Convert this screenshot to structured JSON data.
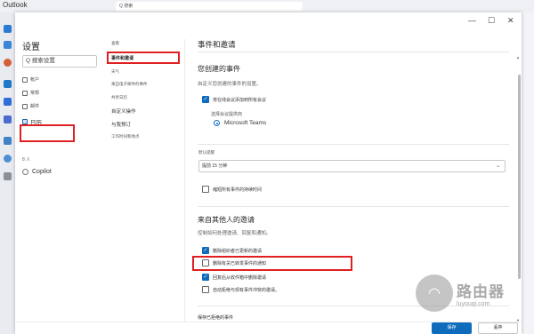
{
  "app": {
    "title": "Outlook",
    "search_placeholder": "Q 搜索"
  },
  "dialog": {
    "controls": {
      "minimize": "—",
      "maximize": "☐",
      "close": "✕"
    },
    "settings_title": "设置",
    "search_placeholder": "Q 搜索设置",
    "nav_primary": [
      {
        "label": "帐户",
        "icon": "person-icon"
      },
      {
        "label": "常规",
        "icon": "settings-icon"
      },
      {
        "label": "邮件",
        "icon": "mail-icon"
      },
      {
        "label": "日历",
        "icon": "calendar-icon",
        "selected": true
      }
    ],
    "people_label": "8 人",
    "copilot_label": "Copilot",
    "nav_secondary": [
      {
        "label": "查看"
      },
      {
        "label": "事件和邀请",
        "selected": true
      },
      {
        "label": "天气"
      },
      {
        "label": "来自电子邮件的事件"
      },
      {
        "label": "共享日历"
      },
      {
        "label": "自定义操作"
      },
      {
        "label": "与我预订"
      },
      {
        "label": "工作时间和地点"
      }
    ],
    "content": {
      "title": "事件和邀请",
      "section1_title": "您创建的事件",
      "section1_desc": "自定义您创建的事件的设置。",
      "cb_add_online_meeting": "将在线会议添加到所有会议",
      "provider_label": "选择会议提供商",
      "provider_option": "Microsoft Teams",
      "reminder_label": "默认提醒",
      "reminder_value": "提前 15 分钟",
      "cb_shorten": "缩短所有事件的持续时间",
      "section2_title": "来自其他人的邀请",
      "section2_desc": "控制如何处理邀请、回复和通知。",
      "cb_delete_updated": "删除组织者已更新的邀请",
      "cb_delete_notice": "删除有关已转发事件的通知",
      "cb_delete_replies": "回复后从收件箱中删除邀请",
      "cb_auto_decline": "自动拒绝与现有事件冲突的邀请。",
      "section3_title": "保存已拒绝的事件"
    },
    "save_label": "保存",
    "cancel_label": "丢弃"
  },
  "watermark": {
    "title": "路由器",
    "url": "luyouqi.com"
  },
  "colors": {
    "accent": "#0f6cbd",
    "highlight": "#e02020"
  }
}
